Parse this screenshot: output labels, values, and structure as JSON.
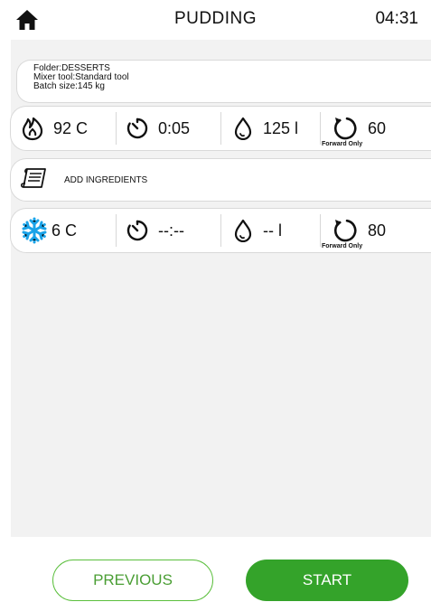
{
  "header": {
    "home_icon": "home-icon",
    "title": "PUDDING",
    "time": "04:31"
  },
  "info": {
    "folder": "Folder:DESSERTS",
    "mixer": "Mixer tool:Standard tool",
    "batch": "Batch size:145 kg"
  },
  "step1": {
    "temperature": "92 C",
    "temperature_icon": "flame-icon",
    "time": "0:05",
    "time_icon": "timer-icon",
    "water": "125 l",
    "water_icon": "water-drop-icon",
    "speed": "60",
    "speed_icon": "rotation-icon",
    "direction": "Forward Only"
  },
  "step2": {
    "icon": "recipe-scroll-icon",
    "label": "ADD INGREDIENTS"
  },
  "step3": {
    "temperature": "6 C",
    "temperature_icon": "snowflake-icon",
    "time": "--:--",
    "time_icon": "timer-icon",
    "water": "-- l",
    "water_icon": "water-drop-icon",
    "speed": "80",
    "speed_icon": "rotation-icon",
    "direction": "Forward Only"
  },
  "footer": {
    "previous_label": "PREVIOUS",
    "start_label": "START"
  },
  "colors": {
    "accent_green": "#34a32a",
    "outline_green": "#5bbf3d",
    "snowflake_blue": "#1aa3e8",
    "panel_bg": "#f2f2f2"
  }
}
